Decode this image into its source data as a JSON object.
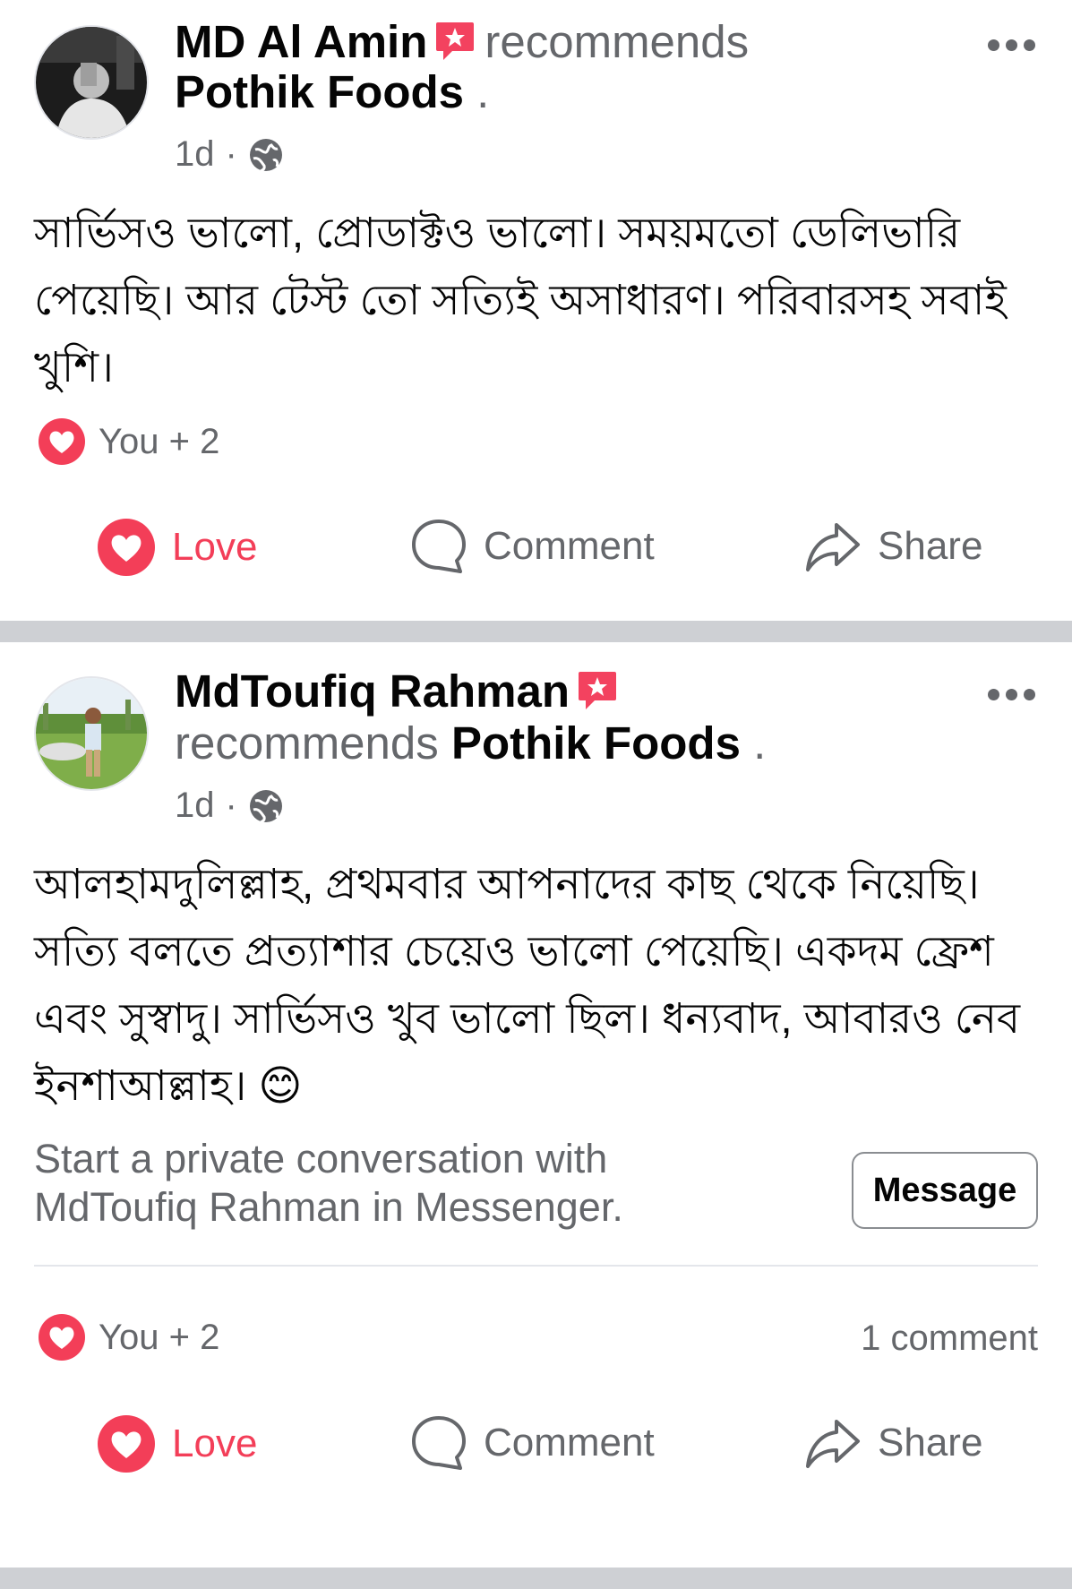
{
  "posts": [
    {
      "author": "MD Al Amin",
      "action_text": "recommends",
      "page_name": "Pothik Foods",
      "trailing": ".",
      "time": "1d",
      "separator": "·",
      "body": "সার্ভিসও ভালো, প্রোডাক্টও ভালো। সময়মতো ডেলিভারি পেয়েছি। আর টেস্ট তো সত্যিই অসাধারণ। পরিবারসহ সবাই খুশি।",
      "reaction_summary": "You + 2",
      "actions": {
        "love": "Love",
        "comment": "Comment",
        "share": "Share"
      }
    },
    {
      "author": "MdToufiq Rahman",
      "action_text": "recommends",
      "page_name": "Pothik Foods",
      "trailing": ".",
      "time": "1d",
      "separator": "·",
      "body": "আলহামদুলিল্লাহ, প্রথমবার আপনাদের কাছ থেকে নিয়েছি। সত্যি বলতে প্রত্যাশার চেয়েও ভালো পেয়েছি। একদম ফ্রেশ এবং সুস্বাদু। সার্ভিসও খুব ভালো ছিল। ধন্যবাদ, আবারও নেব ইনশাআল্লাহ। 😊",
      "message_prompt_line1": "Start a private conversation with",
      "message_prompt_line2": "MdToufiq Rahman in Messenger.",
      "message_button": "Message",
      "reaction_summary": "You + 2",
      "comment_count": "1 comment",
      "actions": {
        "love": "Love",
        "comment": "Comment",
        "share": "Share"
      }
    }
  ],
  "colors": {
    "love": "#f33e58",
    "badge": "#f3425f",
    "muted": "#65676b",
    "divider": "#ced0d4"
  }
}
